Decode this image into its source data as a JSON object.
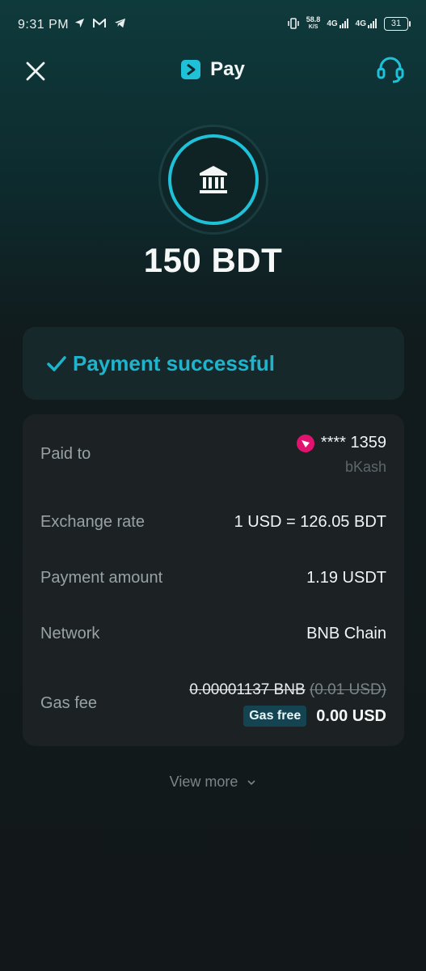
{
  "status_bar": {
    "time": "9:31 PM",
    "speed_value": "58.8",
    "speed_unit": "K/S",
    "network_1": "4G",
    "network_2": "4G",
    "battery": "31"
  },
  "header": {
    "title": "Pay",
    "close_icon": "close-icon",
    "support_icon": "headset-icon",
    "brand_color": "#1fc1d8"
  },
  "hero": {
    "icon": "bank-icon",
    "amount": "150 BDT"
  },
  "status": {
    "icon": "check-icon",
    "text": "Payment successful",
    "color": "#1fb4cc"
  },
  "details": {
    "paid_to": {
      "label": "Paid to",
      "account": "**** 1359",
      "provider": "bKash",
      "provider_color": "#e2136e"
    },
    "exchange_rate": {
      "label": "Exchange rate",
      "value": "1 USD = 126.05 BDT"
    },
    "payment_amount": {
      "label": "Payment amount",
      "value": "1.19 USDT"
    },
    "network": {
      "label": "Network",
      "value": "BNB Chain"
    },
    "gas_fee": {
      "label": "Gas fee",
      "original_bnb": "0.00001137 BNB",
      "original_usd": "(0.01 USD)",
      "badge": "Gas free",
      "value": "0.00 USD"
    }
  },
  "view_more": {
    "label": "View more",
    "icon": "chevron-down-icon"
  }
}
